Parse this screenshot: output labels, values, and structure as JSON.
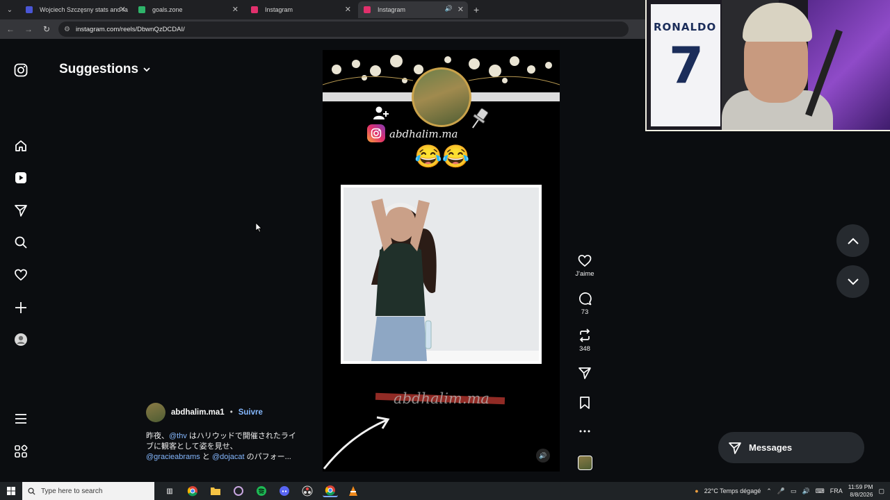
{
  "browser": {
    "tabs": [
      {
        "title": "Wojciech Szczęsny stats and ra",
        "favicon_color": "#4a56d6"
      },
      {
        "title": "goals.zone",
        "favicon_color": "#2eb46a"
      },
      {
        "title": "Instagram",
        "favicon_color": "#e1306c"
      },
      {
        "title": "Instagram",
        "favicon_color": "#e1306c"
      }
    ],
    "active_tab": 3,
    "url": "instagram.com/reels/DbwnQzDCDAI/"
  },
  "sidebar": {
    "icons": [
      "instagram-logo-icon",
      "home-icon",
      "reels-icon",
      "messages-icon",
      "search-icon",
      "notifications-icon",
      "create-icon",
      "profile-icon",
      "menu-icon",
      "more-apps-icon"
    ]
  },
  "page": {
    "suggestions_title": "Suggestions"
  },
  "reel": {
    "overlay_handle": "abdhalim.ma",
    "emojis": "😂😂",
    "watermark": "abdhalim.ma",
    "author": "abdhalim.ma1",
    "separator": "•",
    "follow_label": "Suivre",
    "caption": {
      "line1_pre": "昨夜、",
      "mention1": "@thv",
      "line1_post": " はハリウッドで開催されたライブに観客として姿を見せ、",
      "mention2": "@gracieabrams",
      "mid": " と ",
      "mention3": "@dojacat",
      "tail": " のパフォー..."
    }
  },
  "actions": {
    "like_label": "J'aime",
    "comments_count": "73",
    "reposts_count": "348"
  },
  "messages_label": "Messages",
  "webcam": {
    "jersey_name": "RONALDO",
    "jersey_number": "7"
  },
  "taskbar": {
    "search_placeholder": "Type here to search",
    "weather": "22°C  Temps dégagé",
    "lang": "FRA",
    "time": "11:59 PM",
    "date": "8/8/2026"
  }
}
